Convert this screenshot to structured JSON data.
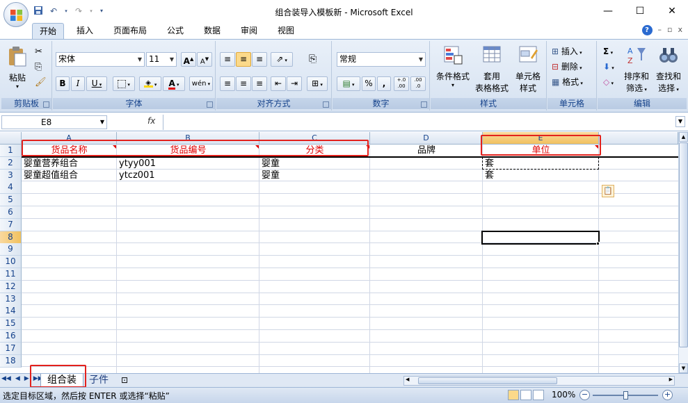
{
  "window": {
    "title": "组合装导入模板新 - Microsoft Excel",
    "controls": {
      "minimize": "—",
      "maximize": "☐",
      "close": "✕"
    }
  },
  "qat": {
    "save_icon": "save-icon",
    "undo_icon": "undo-icon",
    "redo_icon": "redo-icon",
    "customize_icon": "dropdown-icon"
  },
  "tabs": [
    "开始",
    "插入",
    "页面布局",
    "公式",
    "数据",
    "审阅",
    "视图"
  ],
  "tab_right": {
    "help": "?",
    "minimize": "–",
    "restore": "▫",
    "close": "x"
  },
  "ribbon": {
    "clipboard": {
      "paste": "粘贴",
      "label": "剪贴板"
    },
    "font": {
      "name": "宋体",
      "size": "11",
      "label": "字体",
      "bold": "B",
      "italic": "I",
      "underline": "U",
      "grow": "A",
      "shrink": "A",
      "phonetic": "wén",
      "font_color_glyph": "A"
    },
    "alignment": {
      "label": "对齐方式"
    },
    "number": {
      "format": "常规",
      "percent": "%",
      "comma": ",",
      "inc_decimal": "+.0\n.00",
      "dec_decimal": ".00\n.0",
      "label": "数字"
    },
    "styles": {
      "conditional": "条件格式",
      "table_format_1": "套用",
      "table_format_2": "表格格式",
      "cell_styles_1": "单元格",
      "cell_styles_2": "样式",
      "label": "样式"
    },
    "cells": {
      "insert": "插入",
      "delete": "删除",
      "format": "格式",
      "label": "单元格"
    },
    "editing": {
      "sum": "Σ",
      "sort_1": "排序和",
      "sort_2": "筛选",
      "find_1": "查找和",
      "find_2": "选择",
      "label": "编辑"
    }
  },
  "formula_bar": {
    "name_box": "E8",
    "fx": "fx",
    "content": ""
  },
  "sheet": {
    "columns": [
      "A",
      "B",
      "C",
      "D",
      "E"
    ],
    "rows": [
      "1",
      "2",
      "3",
      "4",
      "5",
      "6",
      "7",
      "8",
      "9",
      "10",
      "11",
      "12",
      "13",
      "14",
      "15",
      "16",
      "17",
      "18"
    ],
    "header_row": [
      "货品名称",
      "货品编号",
      "分类",
      "品牌",
      "单位"
    ],
    "data": [
      [
        "婴童营养组合",
        "ytyy001",
        "婴童",
        "",
        "套"
      ],
      [
        "婴童超值组合",
        "ytcz001",
        "婴童",
        "",
        "套"
      ]
    ],
    "active_cell": "E8",
    "paste_options_icon": "paste-options-icon"
  },
  "sheet_tabs": {
    "active": "组合装",
    "other": "子件",
    "nav": [
      "◀◀",
      "◀",
      "▶",
      "▶▶"
    ]
  },
  "status": {
    "message": "选定目标区域，然后按 ENTER 或选择“粘贴”",
    "zoom": "100%",
    "minus": "−",
    "plus": "+"
  },
  "colors": {
    "accent": "#15428b",
    "header_text": "#e00000",
    "highlight_box": "#e3211c",
    "selected_header": "#f1c15f"
  }
}
